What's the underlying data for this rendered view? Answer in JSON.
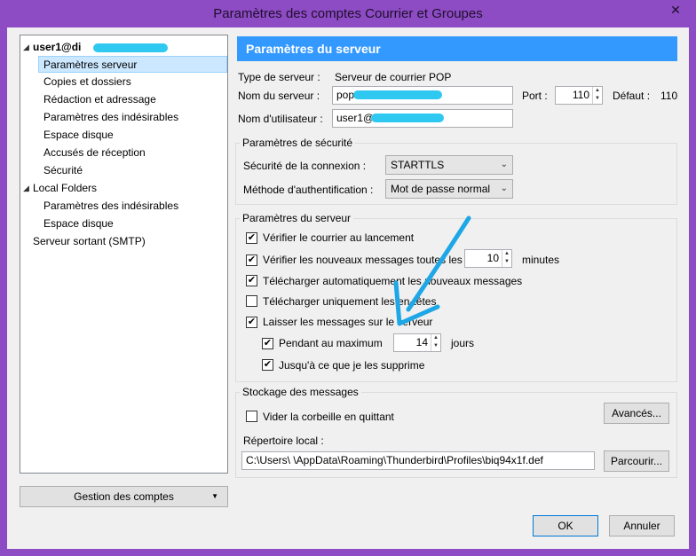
{
  "window": {
    "title": "Paramètres des comptes Courrier et Groupes",
    "close_glyph": "✕"
  },
  "tree": {
    "items": [
      {
        "label": "user1@di",
        "bold": true,
        "expanded": true
      },
      {
        "label": "Paramètres serveur",
        "selected": true
      },
      {
        "label": "Copies et dossiers"
      },
      {
        "label": "Rédaction et adressage"
      },
      {
        "label": "Paramètres des indésirables"
      },
      {
        "label": "Espace disque"
      },
      {
        "label": "Accusés de réception"
      },
      {
        "label": "Sécurité"
      },
      {
        "label": "Local Folders",
        "expanded": true
      },
      {
        "label": "Paramètres des indésirables"
      },
      {
        "label": "Espace disque"
      },
      {
        "label": "Serveur sortant (SMTP)"
      }
    ],
    "manage_button": "Gestion des comptes"
  },
  "panel": {
    "header": "Paramètres du serveur",
    "server_type_label": "Type de serveur :",
    "server_type_value": "Serveur de courrier POP",
    "server_name_label": "Nom du serveur :",
    "server_name_value": "pop",
    "port_label": "Port :",
    "port_value": "110",
    "default_label": "Défaut :",
    "default_value": "110",
    "username_label": "Nom d'utilisateur :",
    "username_value": "user1@"
  },
  "security": {
    "title": "Paramètres de sécurité",
    "connection_label": "Sécurité de la connexion :",
    "connection_value": "STARTTLS",
    "auth_label": "Méthode d'authentification :",
    "auth_value": "Mot de passe normal"
  },
  "server_settings": {
    "title": "Paramètres du serveur",
    "check_startup": {
      "label": "Vérifier le courrier au lancement",
      "checked": true
    },
    "check_every": {
      "label": "Vérifier les nouveaux messages toutes les",
      "checked": true,
      "value": "10",
      "unit": "minutes"
    },
    "auto_download": {
      "label": "Télécharger automatiquement les nouveaux messages",
      "checked": true
    },
    "headers_only": {
      "label": "Télécharger uniquement les en-têtes",
      "checked": false
    },
    "leave_on_server": {
      "label": "Laisser les messages sur le serveur",
      "checked": true
    },
    "at_most": {
      "label": "Pendant au maximum",
      "checked": true,
      "value": "14",
      "unit": "jours"
    },
    "until_delete": {
      "label": "Jusqu'à ce que je les supprime",
      "checked": true
    }
  },
  "storage": {
    "title": "Stockage des messages",
    "empty_trash": {
      "label": "Vider la corbeille en quittant",
      "checked": false
    },
    "advanced_button": "Avancés...",
    "local_dir_label": "Répertoire local :",
    "local_dir_value": "C:\\Users\\               \\AppData\\Roaming\\Thunderbird\\Profiles\\biq94x1f.def",
    "browse_button": "Parcourir..."
  },
  "footer": {
    "ok": "OK",
    "cancel": "Annuler"
  },
  "colors": {
    "title_bar": "#8d4bc4",
    "header": "#3399ff",
    "selection": "#cce8ff",
    "annotation_arrow": "#1ea7e6"
  },
  "check_glyph": "✔"
}
